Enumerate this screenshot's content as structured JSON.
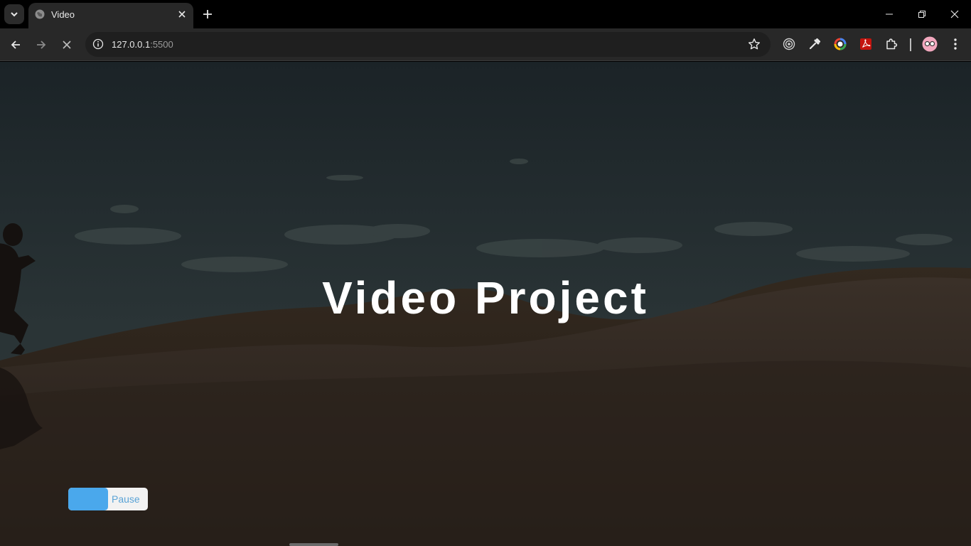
{
  "browser": {
    "tab": {
      "title": "Video",
      "icon": "globe-icon"
    },
    "address": {
      "host": "127.0.0.1",
      "port": ":5500"
    },
    "icons": {
      "tab_search": "chevron-down-icon",
      "tab_close": "close-icon",
      "new_tab": "plus-icon",
      "minimize": "minimize-icon",
      "restore": "restore-icon",
      "window_close": "close-icon",
      "back": "arrow-left-icon",
      "forward": "arrow-right-icon",
      "stop": "stop-loading-icon",
      "site_info": "info-icon",
      "bookmark": "star-icon",
      "extensions": [
        "target-icon",
        "eyedropper-icon",
        "color-wheel-icon",
        "pdf-icon",
        "puzzle-icon"
      ],
      "profile": "avatar-icon",
      "menu": "kebab-menu-icon"
    }
  },
  "page": {
    "heading": "Video Project",
    "toggle": {
      "label": "Pause",
      "knob_color": "#4aa8ec"
    }
  },
  "colors": {
    "accent": "#4aa8ec",
    "heading": "#ffffff"
  }
}
